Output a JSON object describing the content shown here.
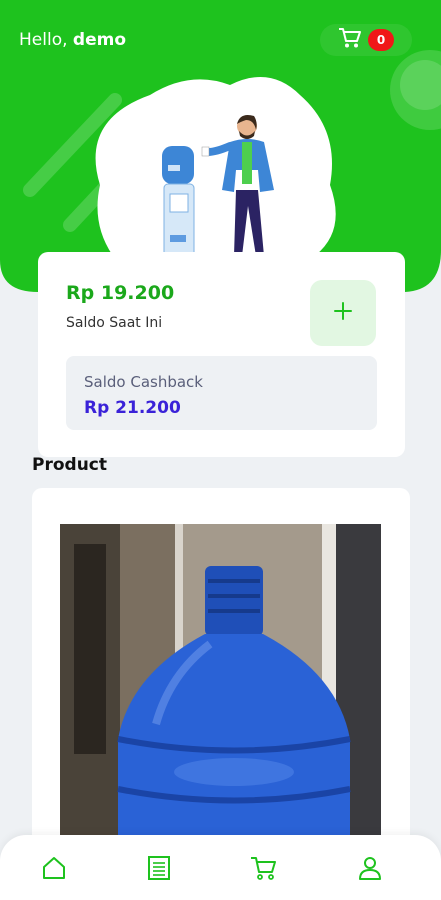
{
  "header": {
    "greeting_prefix": "Hello, ",
    "username": "demo",
    "cart_count": "0"
  },
  "balance": {
    "amount": "Rp 19.200",
    "label": "Saldo Saat Ini",
    "topup_icon": "plus-icon"
  },
  "cashback": {
    "label": "Saldo Cashback",
    "amount": "Rp 21.200"
  },
  "products": {
    "section_title": "Product"
  },
  "bottom_nav": {
    "items": [
      "home-icon",
      "document-icon",
      "cart-icon",
      "user-icon"
    ]
  },
  "colors": {
    "brand_green": "#1ec21e",
    "cashback_blue": "#3a22d8",
    "badge_red": "#f01818"
  }
}
